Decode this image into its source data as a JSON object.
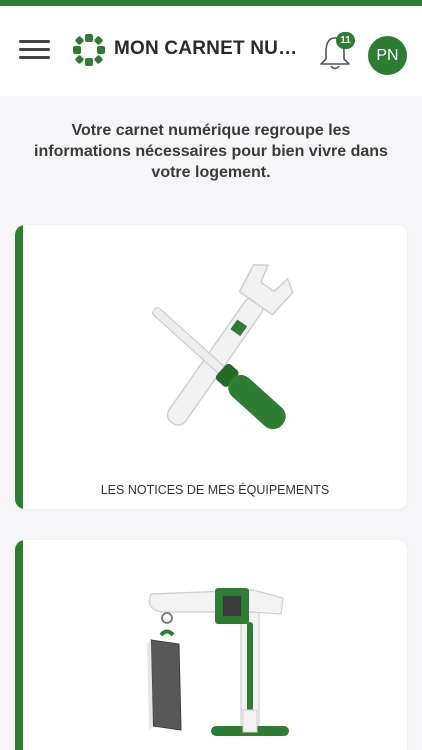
{
  "header": {
    "app_title": "MON CARNET NUMÉRIQUE",
    "notification_count": "11",
    "avatar_initials": "PN"
  },
  "intro_text": "Votre carnet numérique regroupe les informations nécessaires pour bien vivre dans votre logement.",
  "cards": [
    {
      "label": "LES NOTICES DE MES ÉQUIPEMENTS",
      "icon": "tools-illustration"
    },
    {
      "label": "",
      "icon": "crane-illustration"
    }
  ],
  "colors": {
    "accent": "#2e7d32",
    "background": "#f6f6f9"
  }
}
